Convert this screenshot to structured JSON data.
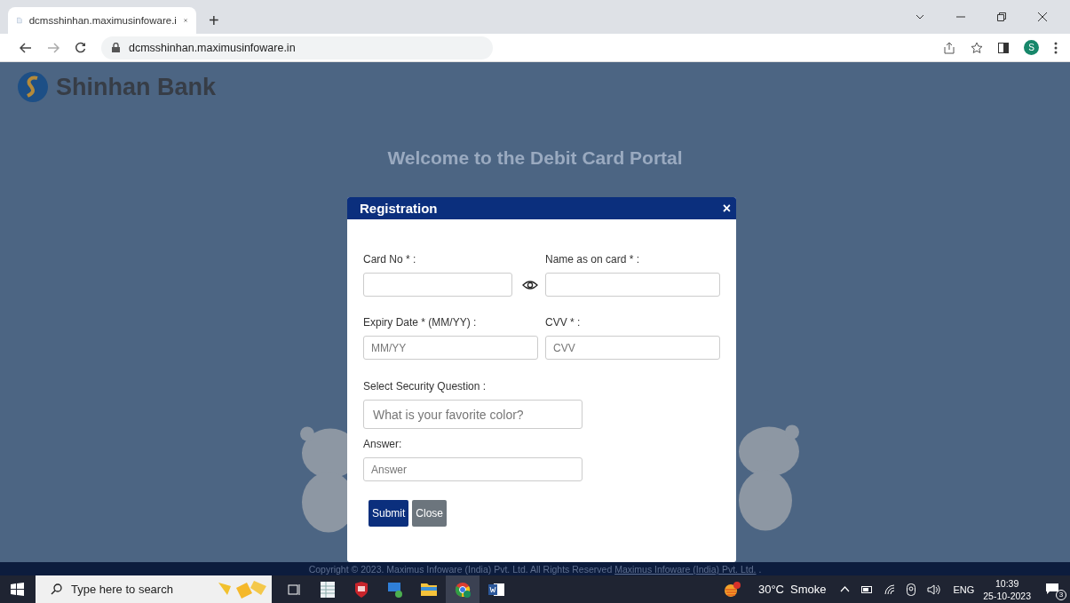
{
  "browser": {
    "tab_title": "dcmsshinhan.maximusinfoware.i",
    "new_tab": "+",
    "url": "dcmsshinhan.maximusinfoware.in",
    "profile": "S"
  },
  "page": {
    "brand": "Shinhan Bank",
    "heading": "Welcome to the Debit Card Portal"
  },
  "dialog": {
    "title": "Registration",
    "close": "×",
    "fields": [
      {
        "label": "Card No * :",
        "kind": "masked"
      },
      {
        "label": "Name as on card * :",
        "kind": "text"
      },
      {
        "label": "Expiry Date * (MM/YY) :",
        "kind": "text",
        "placeholder": "MM/YY"
      },
      {
        "label": "CVV * :",
        "kind": "text",
        "placeholder": "CVV"
      }
    ],
    "extra_fields": [
      {
        "label": "Select Security Question :",
        "kind": "select",
        "placeholder": "What is your favorite color?"
      },
      {
        "label": "Answer:",
        "kind": "text",
        "placeholder": "Answer"
      }
    ],
    "buttons": [
      {
        "label": "Submit",
        "kind": "primary"
      },
      {
        "label": "Close",
        "kind": "secondary"
      }
    ]
  },
  "footer": {
    "text": "Copyright © 2023. Maximus Infoware (India) Pvt. Ltd. All Rights Reserved",
    "link": "Maximus Infoware (India) Pvt. Ltd.",
    "suffix": "."
  },
  "taskbar": {
    "search": {
      "placeholder": "Type here to search"
    },
    "apps": [
      {
        "kind": "taskview",
        "selected": false
      },
      {
        "kind": "sheet",
        "selected": false
      },
      {
        "kind": "shield",
        "selected": false
      },
      {
        "kind": "remote",
        "selected": false
      },
      {
        "kind": "folder",
        "selected": false
      },
      {
        "kind": "chrome",
        "selected": true
      },
      {
        "kind": "word",
        "selected": false
      }
    ],
    "weather": {
      "temp": "30°C",
      "condition": "Smoke"
    },
    "language": "ENG",
    "time": "10:39",
    "date": "25-10-2023",
    "notifications": "3"
  }
}
